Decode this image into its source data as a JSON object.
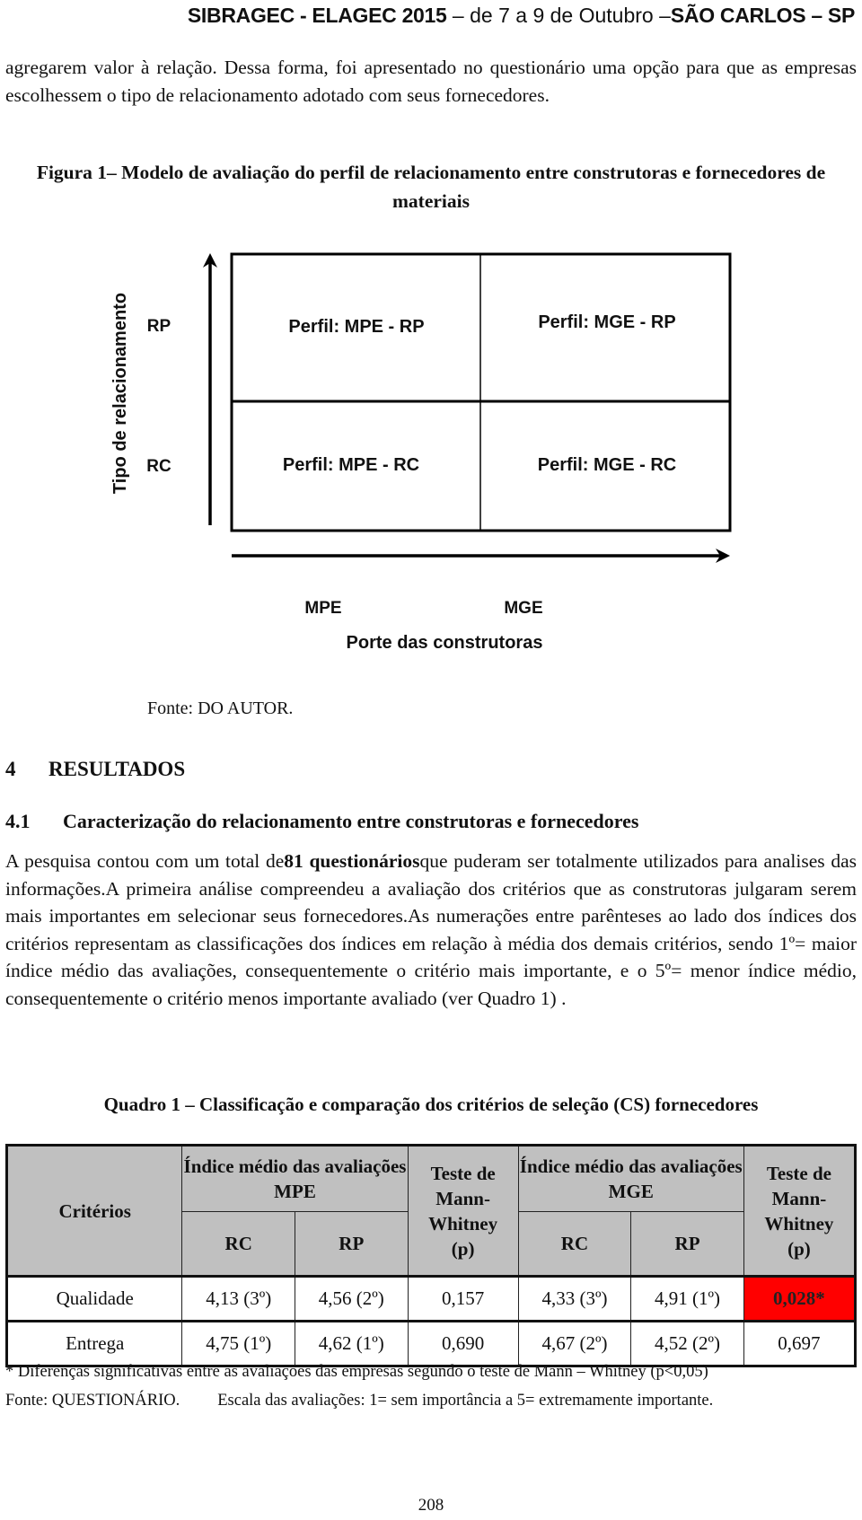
{
  "header": {
    "event": "SIBRAGEC - ELAGEC 2015",
    "dates": " – de 7 a 9 de Outubro –",
    "location": "SÃO CARLOS – SP"
  },
  "paragraph_intro": "agregarem valor à relação. Dessa forma, foi apresentado no questionário uma opção para que as empresas escolhessem o tipo de relacionamento adotado com seus fornecedores.",
  "figure": {
    "caption": "Figura 1– Modelo de avaliação do perfil de relacionamento entre construtoras e fornecedores de materiais",
    "y_axis_label": "Tipo de relacionamento",
    "y_ticks": [
      "RP",
      "RC"
    ],
    "x_axis_label": "Porte das construtoras",
    "x_ticks": [
      "MPE",
      "MGE"
    ],
    "quadrants": [
      "Perfil: MPE - RP",
      "Perfil: MGE - RP",
      "Perfil: MPE - RC",
      "Perfil: MGE - RC"
    ],
    "source": "Fonte: DO AUTOR."
  },
  "section": {
    "number": "4",
    "title": "RESULTADOS"
  },
  "subsection": {
    "number": "4.1",
    "title": "Caracterização do relacionamento entre construtoras e fornecedores"
  },
  "paragraph_results": {
    "before_bold": "A pesquisa contou com um total de",
    "bold": "81 questionários",
    "after_bold": "que puderam ser totalmente utilizados para analises das informações.A primeira análise compreendeu a avaliação dos critérios que as construtoras julgaram serem mais importantes em selecionar seus fornecedores.As numerações entre parênteses ao lado dos índices dos critérios representam as classificações dos índices em relação à média dos demais critérios, sendo 1º= maior índice médio das avaliações, consequentemente o critério mais importante, e o 5º= menor índice médio, consequentemente o critério menos importante avaliado (ver Quadro 1) ."
  },
  "quadro": {
    "title": "Quadro 1 – Classificação e comparação dos critérios de seleção (CS) fornecedores",
    "headers": {
      "criterios": "Critérios",
      "mpe_group": "Índice médio das avaliações MPE",
      "mge_group": "Índice médio das avaliações MGE",
      "mw_line1": "Teste de Mann-Whitney",
      "mw_line2": "(p)",
      "rc": "RC",
      "rp": "RP"
    },
    "rows": [
      {
        "criterio": "Qualidade",
        "mpe_rc": "4,13 (3º)",
        "mpe_rp": "4,56 (2º)",
        "mpe_p": "0,157",
        "mge_rc": "4,33 (3º)",
        "mge_rp": "4,91 (1º)",
        "mge_p": "0,028*"
      },
      {
        "criterio": "Entrega",
        "mpe_rc": "4,75 (1º)",
        "mpe_rp": "4,62 (1º)",
        "mpe_p": "0,690",
        "mge_rc": "4,67 (2º)",
        "mge_rp": "4,52 (2º)",
        "mge_p": "0,697"
      }
    ],
    "highlight_color": "#ff0000",
    "note": "* Diferenças significativas entre as avaliações das empresas segundo o teste de Mann – Whitney (p<0,05)",
    "source": "Fonte: QUESTIONÁRIO.",
    "scale": "Escala das avaliações: 1= sem importância a 5= extremamente importante."
  },
  "page_number": "208"
}
